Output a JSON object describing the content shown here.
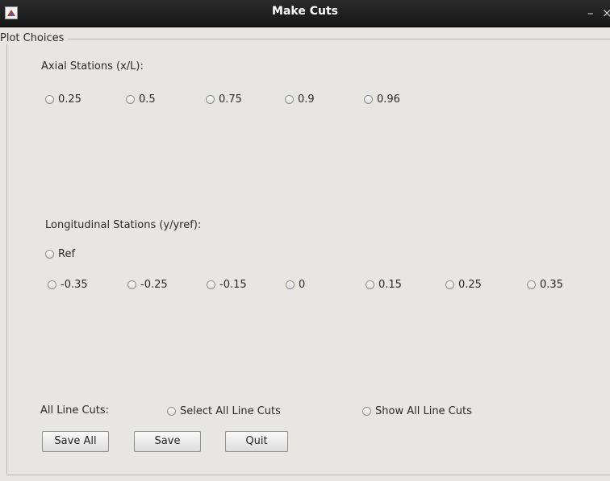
{
  "window": {
    "title": "Make Cuts",
    "minimize_glyph": "–",
    "close_glyph": "×",
    "app_icon": "matlab-icon"
  },
  "plot_choices": {
    "title": "Plot Choices",
    "axial": {
      "label": "Axial Stations (x/L):",
      "options": [
        "0.25",
        "0.5",
        "0.75",
        "0.9",
        "0.96"
      ]
    },
    "longitudinal": {
      "label": "Longitudinal Stations (y/yref):",
      "ref_option": "Ref",
      "options": [
        "-0.35",
        "-0.25",
        "-0.15",
        "0",
        "0.15",
        "0.25",
        "0.35"
      ]
    },
    "line_cuts": {
      "label": "All Line Cuts:",
      "select_all": "Select All Line Cuts",
      "show_all": "Show All Line Cuts"
    }
  },
  "buttons": {
    "save_all": "Save All",
    "save": "Save",
    "quit": "Quit"
  }
}
